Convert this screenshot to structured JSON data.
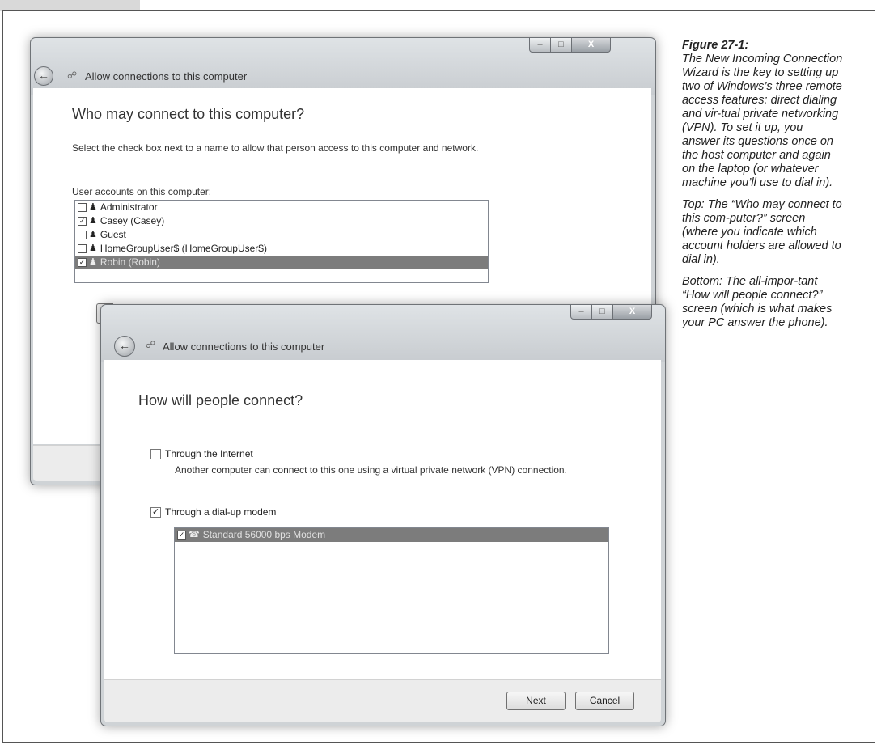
{
  "figure": {
    "label": "Figure 27-1:",
    "description": "The New Incoming Connection Wizard is the key to setting up two of Windows’s three remote access features: direct dialing and vir-tual private networking (VPN). To set it up, you answer its questions once on the host computer and again on the laptop (or whatever machine you’ll use to dial in).",
    "top_note": "Top: The “Who may connect to this com-puter?” screen (where you indicate which account holders are allowed to dial in).",
    "bottom_note": "Bottom: The all-impor-tant “How will people connect?” screen (which is what makes your PC answer the phone)."
  },
  "window_back": {
    "title": "Allow connections to this computer",
    "heading": "Who may connect to this computer?",
    "instructions": "Select the check box next to a name to allow that person access to this computer and network.",
    "list_label": "User accounts on this computer:",
    "accounts": [
      {
        "name": "Administrator",
        "checked": false,
        "selected": false
      },
      {
        "name": "Casey (Casey)",
        "checked": true,
        "selected": false
      },
      {
        "name": "Guest",
        "checked": false,
        "selected": false
      },
      {
        "name": "HomeGroupUser$ (HomeGroupUser$)",
        "checked": false,
        "selected": false
      },
      {
        "name": "Robin (Robin)",
        "checked": true,
        "selected": true
      }
    ]
  },
  "window_front": {
    "title": "Allow connections to this computer",
    "heading": "How will people connect?",
    "option_internet": {
      "label": "Through the Internet",
      "checked": false,
      "description": "Another computer can connect to this one using a virtual private network (VPN) connection."
    },
    "option_modem": {
      "label": "Through a dial-up modem",
      "checked": true
    },
    "modems": [
      {
        "name": "Standard 56000 bps Modem",
        "checked": true,
        "selected": true
      }
    ],
    "buttons": {
      "next": "Next",
      "cancel": "Cancel"
    }
  },
  "window_controls": {
    "minimize": "–",
    "maximize": "□",
    "close": "X"
  },
  "icons": {
    "back": "back-arrow-icon",
    "network": "network-icon",
    "user": "user-icon",
    "modem": "modem-icon"
  }
}
